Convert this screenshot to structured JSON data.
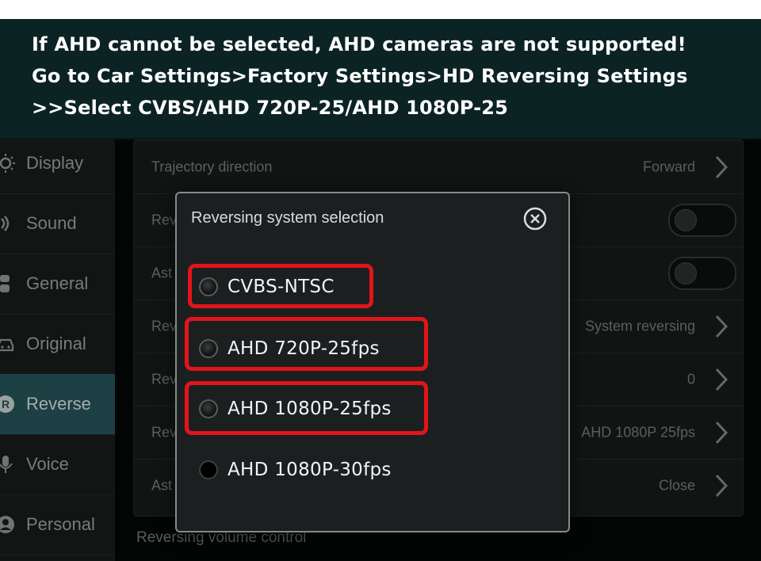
{
  "banner": {
    "lines": [
      "If AHD cannot be selected, AHD cameras are not supported!",
      "Go to Car Settings>Factory Settings>HD Reversing Settings",
      ">>Select CVBS/AHD 720P-25/AHD 1080P-25"
    ]
  },
  "sidebar": {
    "items": [
      {
        "label": "Display",
        "icon": "sun-icon"
      },
      {
        "label": "Sound",
        "icon": "speaker-icon"
      },
      {
        "label": "General",
        "icon": "sliders-icon"
      },
      {
        "label": "Original",
        "icon": "car-icon"
      },
      {
        "label": "Reverse",
        "icon": "reverse-icon",
        "active": true
      },
      {
        "label": "Voice",
        "icon": "microphone-icon"
      },
      {
        "label": "Personal",
        "icon": "person-icon"
      }
    ]
  },
  "settings": {
    "rows": [
      {
        "label": "Trajectory direction",
        "value": "Forward"
      },
      {
        "label": "Rev",
        "toggle": "off"
      },
      {
        "label": "Ast",
        "toggle": "off"
      },
      {
        "label": "Rev",
        "value": "System reversing"
      },
      {
        "label": "Rev",
        "value": "0"
      },
      {
        "label": "Rev",
        "value": "AHD 1080P 25fps"
      },
      {
        "label": "Ast",
        "value": "Close"
      }
    ],
    "bottom_label": "Reversing volume control"
  },
  "dialog": {
    "title": "Reversing system selection",
    "options": [
      {
        "label": "CVBS-NTSC",
        "highlighted": true
      },
      {
        "label": "AHD 720P-25fps",
        "highlighted": true
      },
      {
        "label": "AHD 1080P-25fps",
        "highlighted": true
      },
      {
        "label": "AHD 1080P-30fps",
        "highlighted": false
      }
    ]
  },
  "colors": {
    "banner_bg": "#0b2323",
    "sidebar_active": "#27595f",
    "highlight": "#e2141b"
  }
}
